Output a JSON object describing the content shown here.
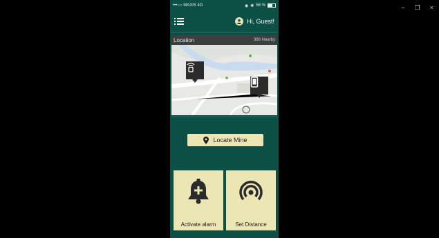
{
  "window": {
    "minimize": "−",
    "restore": "❐",
    "close": "×"
  },
  "status": {
    "carrier": "•••○○ MAXIS 4G",
    "battery": "58 %",
    "battery_level": 0.58
  },
  "appbar": {
    "greeting": "Hi, Guest!"
  },
  "location": {
    "title": "Location",
    "nearby": "386 Nearby"
  },
  "actions": {
    "locate": "Locate Mine",
    "activate_alarm": "Activate alarm",
    "set_distance": "Set Distance"
  },
  "icons": {
    "menu": "list-menu-icon",
    "avatar": "user-icon",
    "locate": "location-pin-icon",
    "alarm": "bell-plus-icon",
    "distance": "signal-rings-icon",
    "beacon": "tag-device-icon",
    "phone": "smartphone-icon"
  },
  "colors": {
    "primary": "#0b4f45",
    "accent": "#ece6b5",
    "dark": "#2b2b2b"
  }
}
